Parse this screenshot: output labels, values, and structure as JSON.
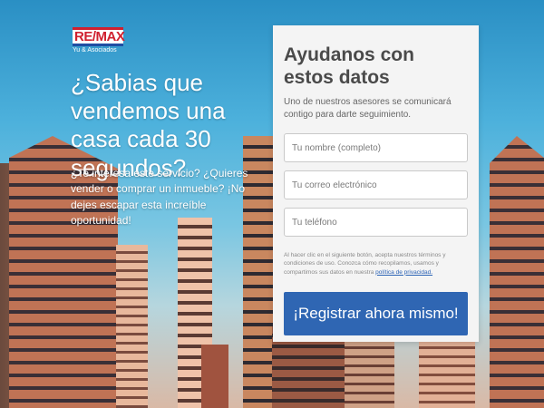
{
  "brand": {
    "logo_text": "RE/MAX",
    "subtitle": "Yu & Asociados"
  },
  "hero": {
    "headline": "¿Sabias que vendemos una casa cada 30 segundos?",
    "lead": "¿Te interesa este servicio? ¿Quieres vender o comprar un inmueble? ¡No dejes escapar esta increíble oportunidad!"
  },
  "form": {
    "title": "Ayudanos con estos datos",
    "subtitle": "Uno de nuestros asesores se comunicará contigo para darte seguimiento.",
    "fields": {
      "name_placeholder": "Tu nombre (completo)",
      "email_placeholder": "Tu correo electrónico",
      "phone_placeholder": "Tu teléfono"
    },
    "legal_text": "Al hacer clic en el siguiente botón, acepta nuestros términos y condiciones de uso. Conozca cómo recopilamos, usamos y compartimos sus datos en nuestra",
    "privacy_link": "política de privacidad.",
    "submit_label": "¡Registrar ahora mismo!"
  },
  "colors": {
    "brand_red": "#d0202f",
    "brand_blue": "#1f4ea3",
    "button": "#2f66b3"
  }
}
